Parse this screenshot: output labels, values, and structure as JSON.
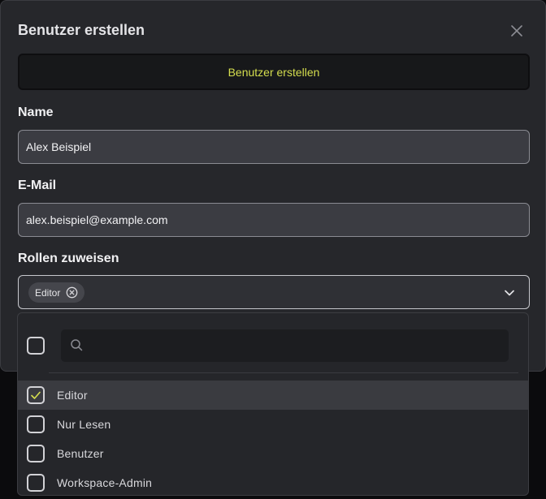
{
  "modal": {
    "title": "Benutzer erstellen",
    "submit_label": "Benutzer erstellen"
  },
  "fields": {
    "name_label": "Name",
    "name_value": "Alex Beispiel",
    "email_label": "E-Mail",
    "email_value": "alex.beispiel@example.com",
    "roles_label": "Rollen zuweisen"
  },
  "roles": {
    "selected_chips": [
      "Editor"
    ],
    "options": [
      {
        "label": "Editor",
        "checked": true
      },
      {
        "label": "Nur Lesen",
        "checked": false
      },
      {
        "label": "Benutzer",
        "checked": false
      },
      {
        "label": "Workspace-Admin",
        "checked": false
      }
    ],
    "search_placeholder": ""
  },
  "colors": {
    "accent": "#d5de4e",
    "modal_bg": "#26272b",
    "input_bg": "#3b3c42"
  },
  "icons": {
    "close": "close-icon",
    "chip_remove": "circle-x-icon",
    "dropdown": "chevron-down-icon",
    "search": "search-icon",
    "check": "check-icon"
  }
}
